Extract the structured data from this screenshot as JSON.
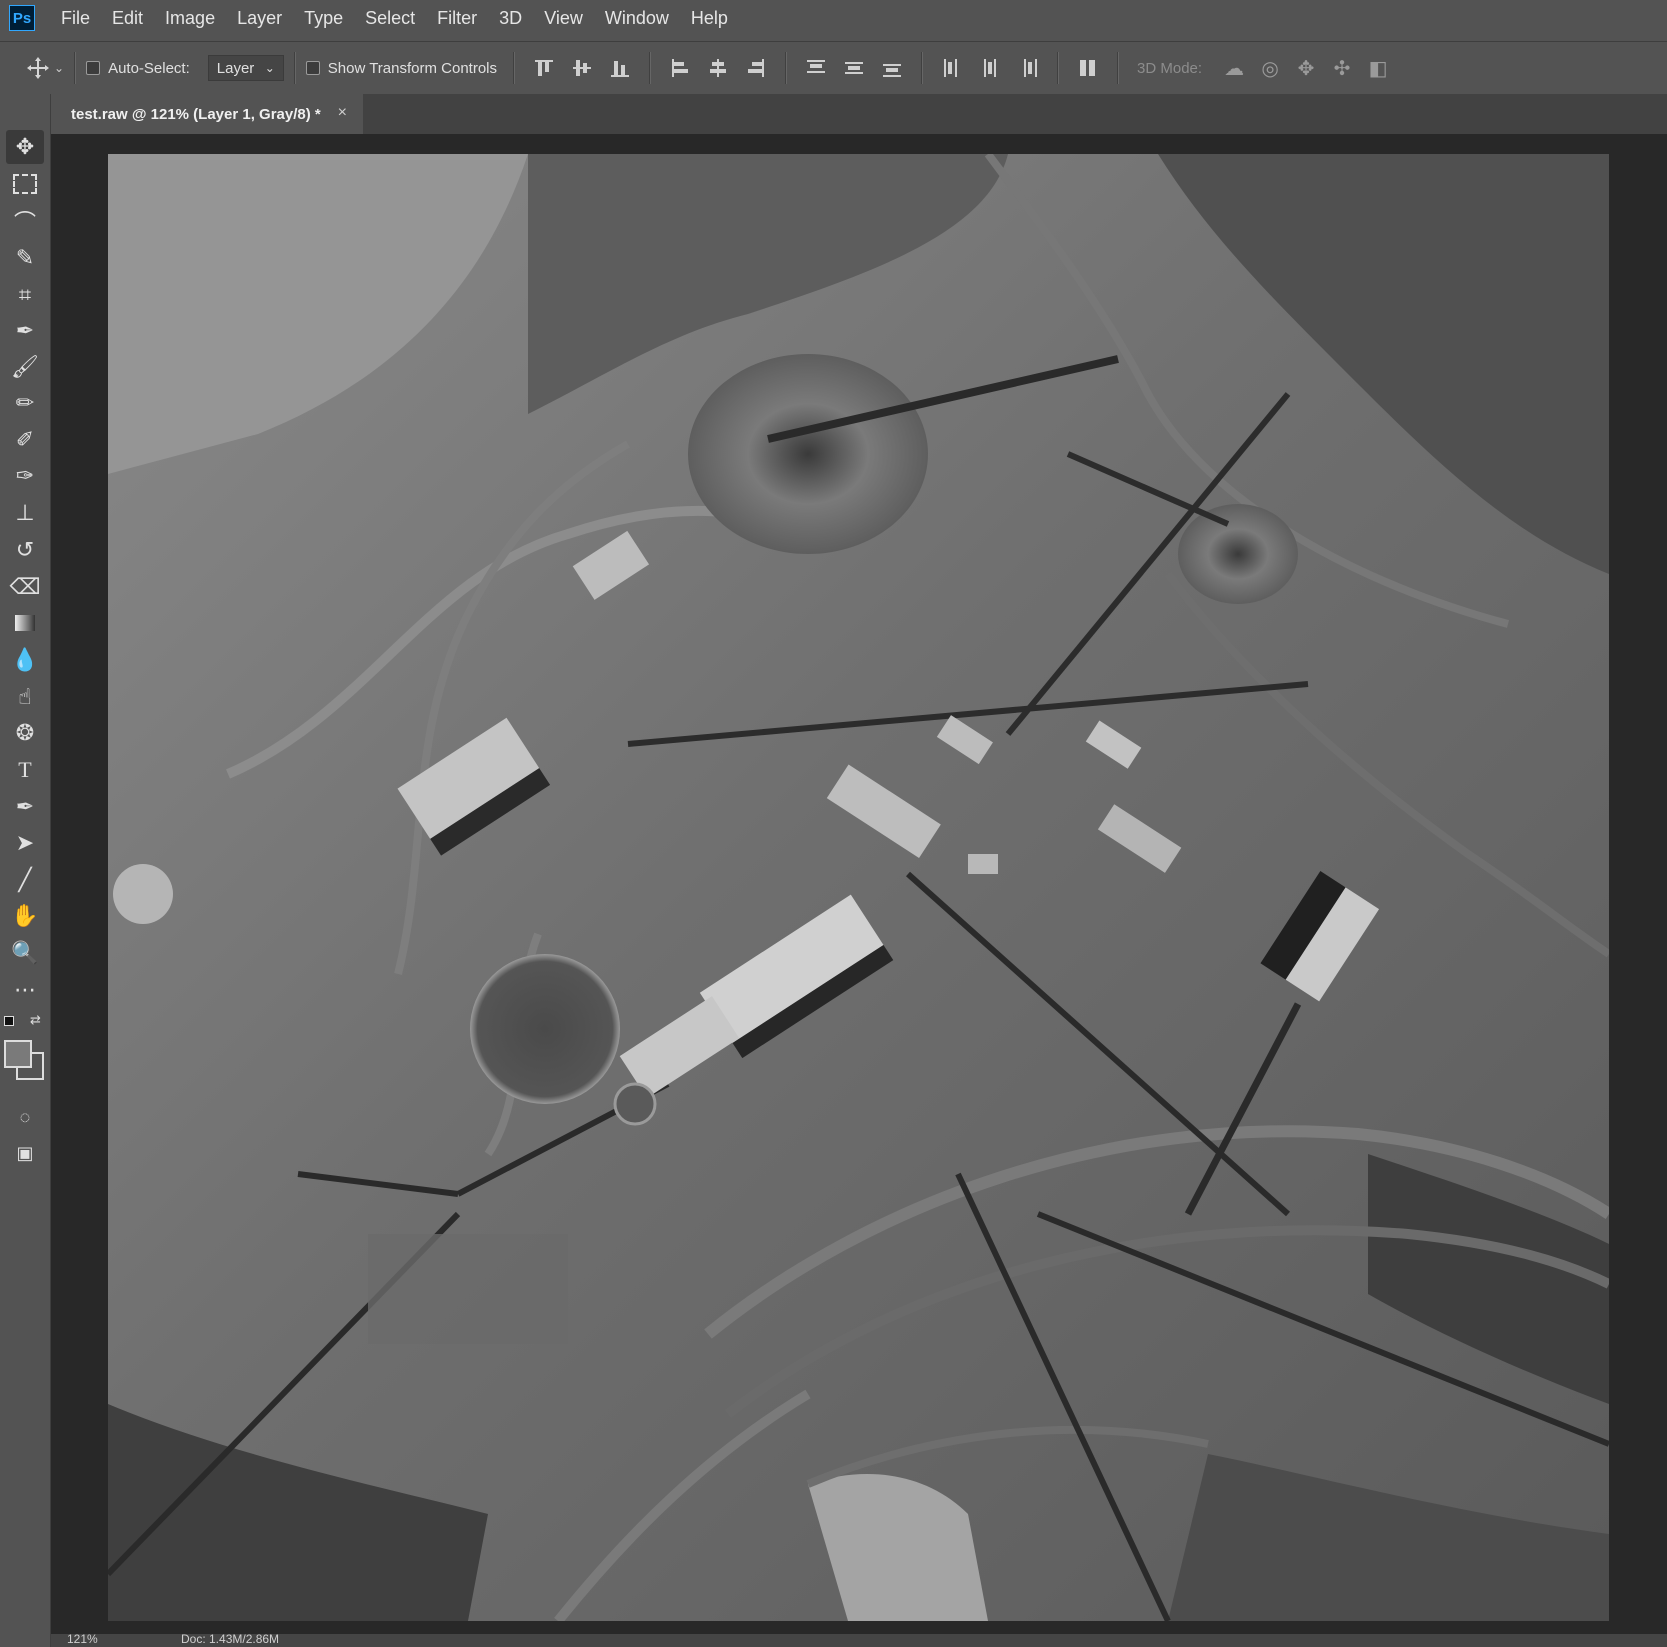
{
  "app": {
    "logo": "Ps"
  },
  "menu": [
    "File",
    "Edit",
    "Image",
    "Layer",
    "Type",
    "Select",
    "Filter",
    "3D",
    "View",
    "Window",
    "Help"
  ],
  "options": {
    "auto_select_label": "Auto-Select:",
    "auto_select_value": "Layer",
    "show_transform_label": "Show Transform Controls",
    "mode3d_label": "3D Mode:"
  },
  "document": {
    "tab_title": "test.raw @ 121% (Layer 1, Gray/8) *",
    "close_glyph": "×"
  },
  "status": {
    "zoom": "121%",
    "doc_size": "Doc: 1.43M/2.86M"
  },
  "tools": [
    "move-tool",
    "marquee-tool",
    "lasso-tool",
    "quick-select-tool",
    "crop-tool",
    "eyedropper-tool",
    "healing-brush-tool",
    "brush-tool",
    "clone-stamp-tool",
    "history-brush-tool",
    "eraser-tool",
    "gradient-tool",
    "blur-tool",
    "dodge-tool",
    "sponge-tool",
    "type-tool",
    "pen-tool",
    "path-select-tool",
    "line-tool",
    "hand-tool",
    "zoom-tool",
    "more-tools"
  ],
  "colors": {
    "ui_bg": "#535353",
    "doc_bg": "#282828",
    "accent": "#31a8ff"
  }
}
